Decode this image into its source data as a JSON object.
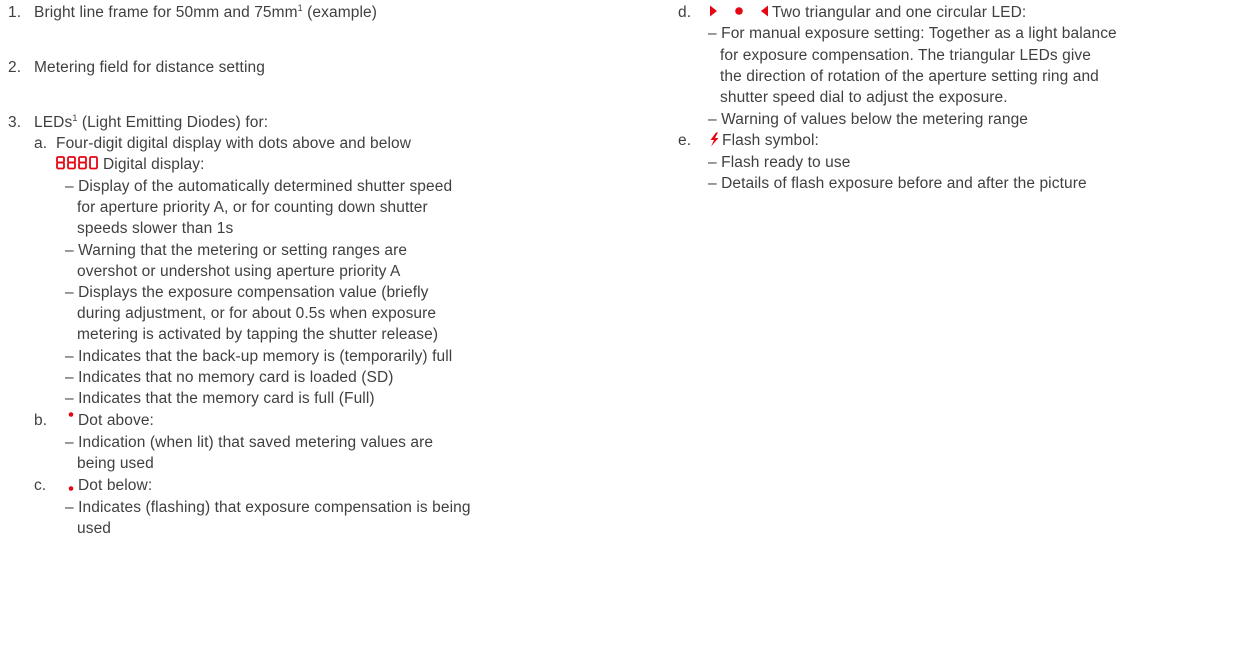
{
  "left": {
    "item1": {
      "num": "1.",
      "text_before": "Bright line frame for 50mm and 75mm",
      "sup": "1",
      "text_after": " (example)"
    },
    "item2": {
      "num": "2.",
      "text": "Metering field for distance setting"
    },
    "item3": {
      "num": "3.",
      "text_before": "LEDs",
      "sup": "1",
      "text_after": " (Light Emitting Diodes) for:",
      "a": {
        "letter": "a.",
        "title": "Four-digit digital display with dots above and below",
        "display_label": "Digital display:",
        "bullets": [
          [
            "– Display of the automatically determined shutter speed",
            "for aperture priority A, or for counting down shutter",
            "speeds slower than 1s"
          ],
          [
            "– Warning that the metering or setting ranges are",
            "overshot or undershot using aperture priority A"
          ],
          [
            "– Displays the exposure compensation value (briefly",
            "during adjustment, or for about 0.5s when exposure",
            "metering is activated by tapping the shutter release)"
          ],
          [
            "– Indicates that the back-up memory is (temporarily) full"
          ],
          [
            "– Indicates that no memory card is loaded (SD)"
          ],
          [
            "– Indicates that the memory card is full (Full)"
          ]
        ]
      },
      "b": {
        "letter": "b.",
        "label": "Dot above:",
        "bullets": [
          [
            "– Indication (when lit) that saved metering values are",
            "being used"
          ]
        ]
      },
      "c": {
        "letter": "c.",
        "label": "Dot below:",
        "bullets": [
          [
            "– Indicates (flashing) that exposure compensation is being",
            "used"
          ]
        ]
      }
    }
  },
  "right": {
    "d": {
      "letter": "d.",
      "label": "Two triangular and one circular LED:",
      "bullets": [
        [
          "– For manual exposure setting: Together as a light balance",
          "for exposure compensation. The triangular LEDs give",
          "the direction of rotation of the aperture setting ring and",
          "shutter speed dial to adjust the exposure."
        ],
        [
          "– Warning of values below the metering range"
        ]
      ]
    },
    "e": {
      "letter": "e.",
      "label": "Flash symbol:",
      "bullets": [
        [
          "– Flash ready to use"
        ],
        [
          "– Details of flash exposure before and after the picture"
        ]
      ]
    }
  },
  "colors": {
    "text": "#404040",
    "led_red": "#e30613"
  },
  "icons": {
    "digital_display": "seven-segment-8880-icon",
    "dot_above": "dot-above-icon",
    "dot_below": "dot-below-icon",
    "leds": "triangle-circle-triangle-icon",
    "flash": "flash-bolt-icon"
  }
}
